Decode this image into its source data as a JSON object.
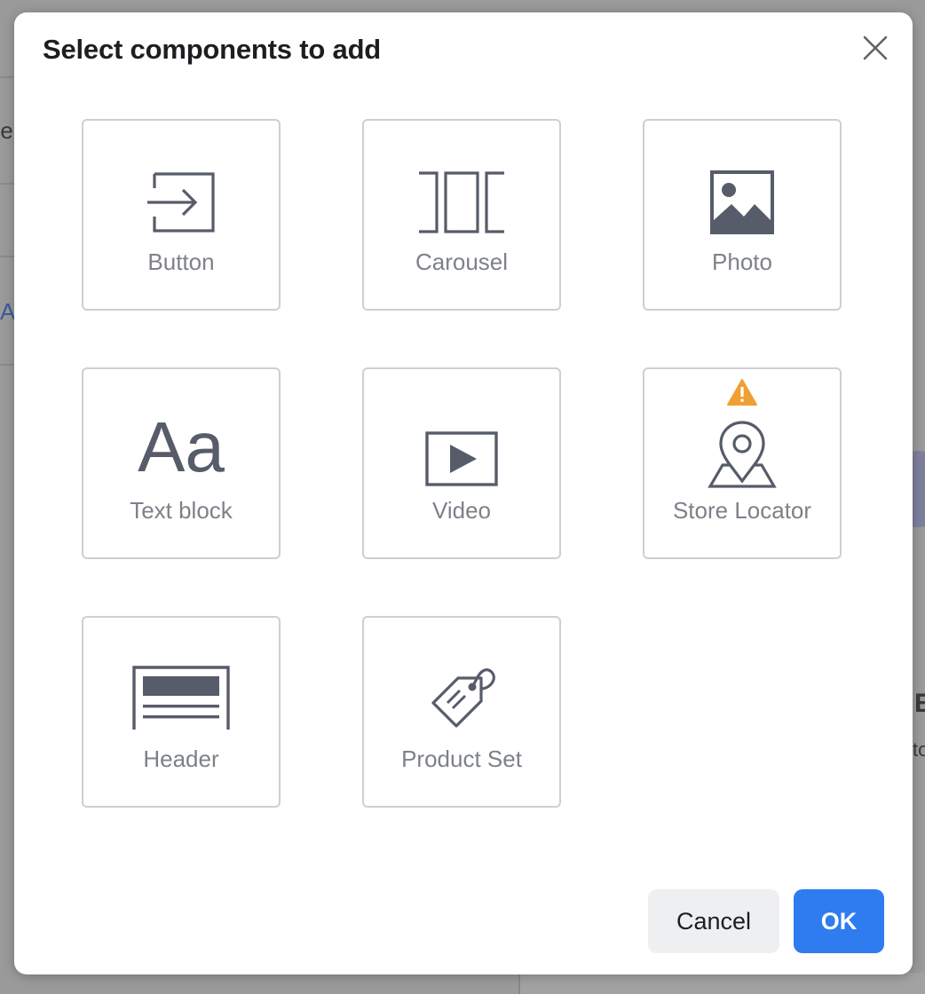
{
  "background": {
    "fragments": [
      "rie",
      "A",
      "E",
      "to"
    ]
  },
  "dialog": {
    "title": "Select components to add",
    "close_icon": "close-icon",
    "components": [
      {
        "label": "Button",
        "icon": "button-icon"
      },
      {
        "label": "Carousel",
        "icon": "carousel-icon"
      },
      {
        "label": "Photo",
        "icon": "photo-icon"
      },
      {
        "label": "Text block",
        "icon": "text-block-icon",
        "glyph": "Aa"
      },
      {
        "label": "Video",
        "icon": "video-icon"
      },
      {
        "label": "Store Locator",
        "icon": "store-locator-icon",
        "warning": "warning-icon"
      },
      {
        "label": "Header",
        "icon": "header-icon"
      },
      {
        "label": "Product Set",
        "icon": "product-set-icon"
      }
    ],
    "buttons": {
      "cancel": "Cancel",
      "ok": "OK"
    }
  },
  "colors": {
    "icon": "#575c6a",
    "label": "#7d8188",
    "tile_border": "#ccd0d5",
    "primary": "#2e7cf0",
    "warning": "#f0a033"
  }
}
